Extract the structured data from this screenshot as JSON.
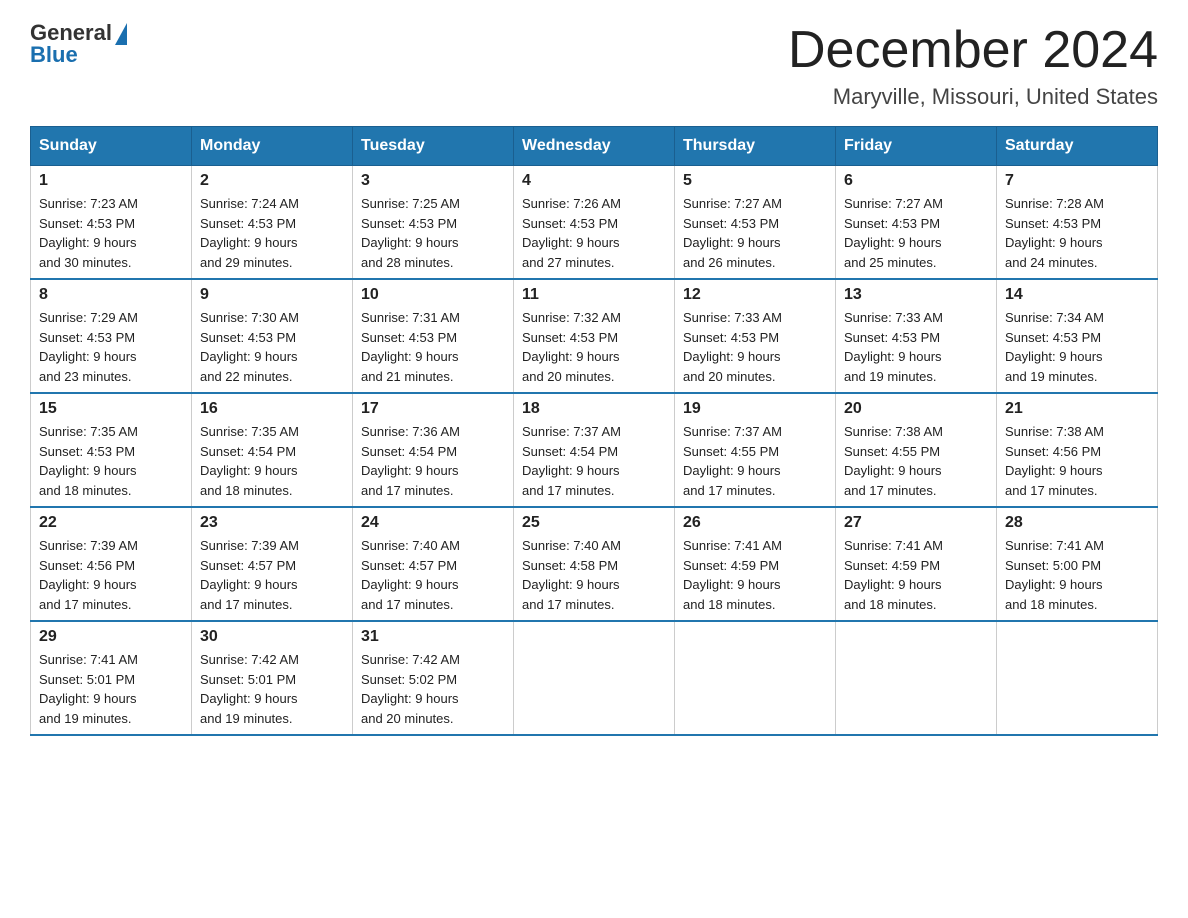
{
  "logo": {
    "general": "General",
    "blue": "Blue"
  },
  "header": {
    "title": "December 2024",
    "location": "Maryville, Missouri, United States"
  },
  "weekdays": [
    "Sunday",
    "Monday",
    "Tuesday",
    "Wednesday",
    "Thursday",
    "Friday",
    "Saturday"
  ],
  "weeks": [
    [
      {
        "day": "1",
        "sunrise": "7:23 AM",
        "sunset": "4:53 PM",
        "daylight": "9 hours and 30 minutes."
      },
      {
        "day": "2",
        "sunrise": "7:24 AM",
        "sunset": "4:53 PM",
        "daylight": "9 hours and 29 minutes."
      },
      {
        "day": "3",
        "sunrise": "7:25 AM",
        "sunset": "4:53 PM",
        "daylight": "9 hours and 28 minutes."
      },
      {
        "day": "4",
        "sunrise": "7:26 AM",
        "sunset": "4:53 PM",
        "daylight": "9 hours and 27 minutes."
      },
      {
        "day": "5",
        "sunrise": "7:27 AM",
        "sunset": "4:53 PM",
        "daylight": "9 hours and 26 minutes."
      },
      {
        "day": "6",
        "sunrise": "7:27 AM",
        "sunset": "4:53 PM",
        "daylight": "9 hours and 25 minutes."
      },
      {
        "day": "7",
        "sunrise": "7:28 AM",
        "sunset": "4:53 PM",
        "daylight": "9 hours and 24 minutes."
      }
    ],
    [
      {
        "day": "8",
        "sunrise": "7:29 AM",
        "sunset": "4:53 PM",
        "daylight": "9 hours and 23 minutes."
      },
      {
        "day": "9",
        "sunrise": "7:30 AM",
        "sunset": "4:53 PM",
        "daylight": "9 hours and 22 minutes."
      },
      {
        "day": "10",
        "sunrise": "7:31 AM",
        "sunset": "4:53 PM",
        "daylight": "9 hours and 21 minutes."
      },
      {
        "day": "11",
        "sunrise": "7:32 AM",
        "sunset": "4:53 PM",
        "daylight": "9 hours and 20 minutes."
      },
      {
        "day": "12",
        "sunrise": "7:33 AM",
        "sunset": "4:53 PM",
        "daylight": "9 hours and 20 minutes."
      },
      {
        "day": "13",
        "sunrise": "7:33 AM",
        "sunset": "4:53 PM",
        "daylight": "9 hours and 19 minutes."
      },
      {
        "day": "14",
        "sunrise": "7:34 AM",
        "sunset": "4:53 PM",
        "daylight": "9 hours and 19 minutes."
      }
    ],
    [
      {
        "day": "15",
        "sunrise": "7:35 AM",
        "sunset": "4:53 PM",
        "daylight": "9 hours and 18 minutes."
      },
      {
        "day": "16",
        "sunrise": "7:35 AM",
        "sunset": "4:54 PM",
        "daylight": "9 hours and 18 minutes."
      },
      {
        "day": "17",
        "sunrise": "7:36 AM",
        "sunset": "4:54 PM",
        "daylight": "9 hours and 17 minutes."
      },
      {
        "day": "18",
        "sunrise": "7:37 AM",
        "sunset": "4:54 PM",
        "daylight": "9 hours and 17 minutes."
      },
      {
        "day": "19",
        "sunrise": "7:37 AM",
        "sunset": "4:55 PM",
        "daylight": "9 hours and 17 minutes."
      },
      {
        "day": "20",
        "sunrise": "7:38 AM",
        "sunset": "4:55 PM",
        "daylight": "9 hours and 17 minutes."
      },
      {
        "day": "21",
        "sunrise": "7:38 AM",
        "sunset": "4:56 PM",
        "daylight": "9 hours and 17 minutes."
      }
    ],
    [
      {
        "day": "22",
        "sunrise": "7:39 AM",
        "sunset": "4:56 PM",
        "daylight": "9 hours and 17 minutes."
      },
      {
        "day": "23",
        "sunrise": "7:39 AM",
        "sunset": "4:57 PM",
        "daylight": "9 hours and 17 minutes."
      },
      {
        "day": "24",
        "sunrise": "7:40 AM",
        "sunset": "4:57 PM",
        "daylight": "9 hours and 17 minutes."
      },
      {
        "day": "25",
        "sunrise": "7:40 AM",
        "sunset": "4:58 PM",
        "daylight": "9 hours and 17 minutes."
      },
      {
        "day": "26",
        "sunrise": "7:41 AM",
        "sunset": "4:59 PM",
        "daylight": "9 hours and 18 minutes."
      },
      {
        "day": "27",
        "sunrise": "7:41 AM",
        "sunset": "4:59 PM",
        "daylight": "9 hours and 18 minutes."
      },
      {
        "day": "28",
        "sunrise": "7:41 AM",
        "sunset": "5:00 PM",
        "daylight": "9 hours and 18 minutes."
      }
    ],
    [
      {
        "day": "29",
        "sunrise": "7:41 AM",
        "sunset": "5:01 PM",
        "daylight": "9 hours and 19 minutes."
      },
      {
        "day": "30",
        "sunrise": "7:42 AM",
        "sunset": "5:01 PM",
        "daylight": "9 hours and 19 minutes."
      },
      {
        "day": "31",
        "sunrise": "7:42 AM",
        "sunset": "5:02 PM",
        "daylight": "9 hours and 20 minutes."
      },
      null,
      null,
      null,
      null
    ]
  ]
}
